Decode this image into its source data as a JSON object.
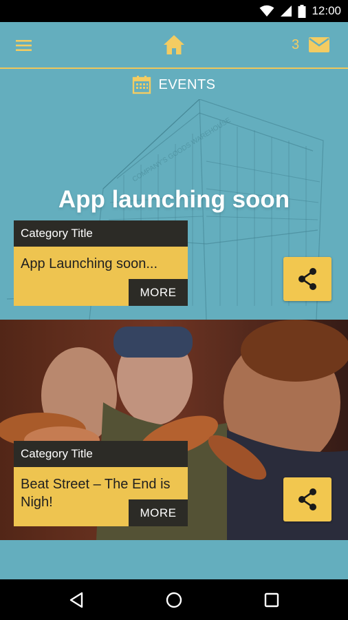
{
  "status_bar": {
    "time": "12:00"
  },
  "app_bar": {
    "message_count": "3"
  },
  "section": {
    "label": "EVENTS"
  },
  "events": [
    {
      "hero_text": "App launching soon",
      "category": "Category Title",
      "title": "App Launching soon...",
      "more_label": "MORE"
    },
    {
      "category": "Category Title",
      "title": "Beat Street – The End is Nigh!",
      "more_label": "MORE"
    }
  ],
  "colors": {
    "teal": "#64aebe",
    "accent": "#f0c75a",
    "dark": "#2c2b26"
  },
  "icons": [
    "wifi-icon",
    "signal-icon",
    "battery-icon",
    "menu-icon",
    "home-icon",
    "mail-icon",
    "calendar-icon",
    "share-icon",
    "back-icon",
    "home-circle-icon",
    "recents-icon"
  ]
}
